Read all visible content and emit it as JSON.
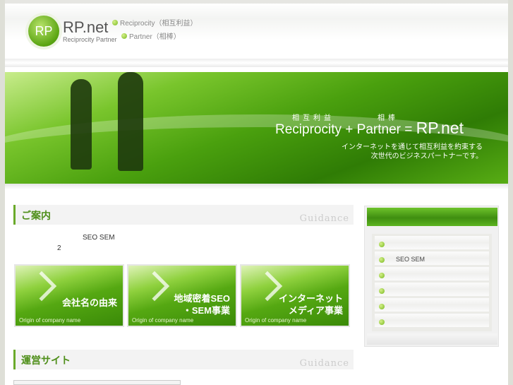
{
  "header": {
    "logo_mark": "RP",
    "logo_name": "RP.net",
    "logo_sub": "Reciprocity Partner",
    "tag1": "Reciprocity（相互利益）",
    "tag2": "Partner（相棒）"
  },
  "banner": {
    "small1": "相互利益",
    "small2": "相棒",
    "main_a": "Reciprocity",
    "plus": "+",
    "main_b": "Partner = ",
    "main_c": "RP.net",
    "copy1": "インターネットを通じて相互利益を約束する",
    "copy2": "次世代のビジネスパートナーです。"
  },
  "guidance": {
    "title": "ご案内",
    "sub": "Guidance",
    "line1": "SEO SEM",
    "line2": "2"
  },
  "cards": [
    {
      "title": "会社名の由来",
      "sub": "Origin of company name"
    },
    {
      "title": "地域密着SEO\n・SEM事業",
      "sub": "Origin of company name"
    },
    {
      "title": "インターネット\nメディア事業",
      "sub": "Origin of company name"
    }
  ],
  "sites": {
    "title": "運営サイト",
    "sub": "Guidance"
  },
  "sidebar": {
    "items": [
      "",
      "SEO SEM",
      "",
      "",
      "",
      ""
    ]
  },
  "colors": {
    "accent": "#5aa412",
    "heading": "#4f8f1a"
  }
}
